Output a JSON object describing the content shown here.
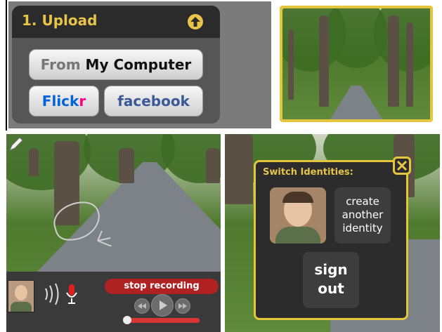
{
  "upload": {
    "title": "1. Upload",
    "from_label": "From",
    "computer_label": "My Computer",
    "flickr_part1": "Flick",
    "flickr_part2": "r",
    "facebook_label": "facebook"
  },
  "recording": {
    "stop_label": "stop recording",
    "progress": 0.95
  },
  "identities": {
    "title": "Switch Identities:",
    "create_line1": "create",
    "create_line2": "another",
    "create_line3": "identity",
    "signout_line1": "sign",
    "signout_line2": "out"
  },
  "colors": {
    "accent_yellow": "#e3c53e",
    "record_red": "#b02121",
    "flickr_blue": "#0063dc",
    "flickr_pink": "#ff0084",
    "facebook_blue": "#3b5998"
  },
  "icons": [
    "upload-arrow-icon",
    "pencil-icon",
    "sound-waves-icon",
    "microphone-icon",
    "rewind-icon",
    "play-icon",
    "fast-forward-icon",
    "close-icon"
  ]
}
